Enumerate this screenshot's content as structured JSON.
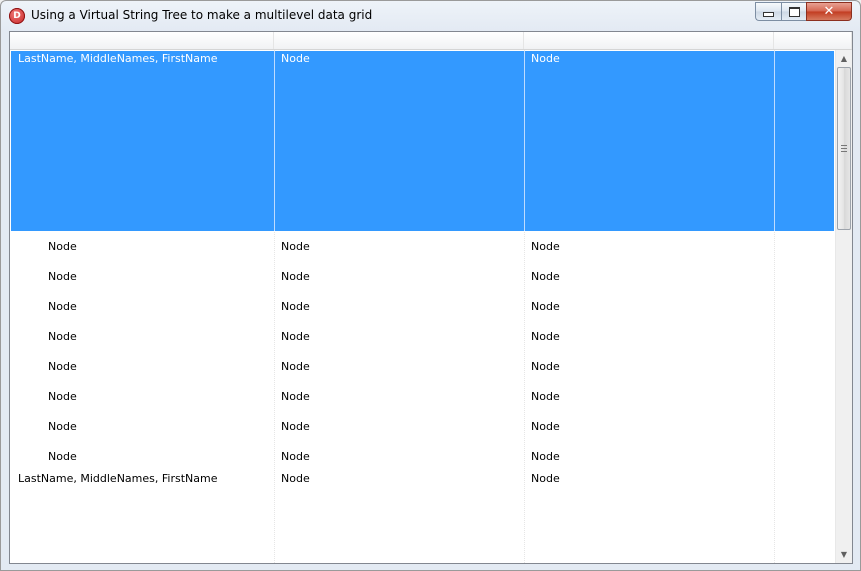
{
  "window": {
    "title": "Using a Virtual String Tree to make a multilevel data grid",
    "icon": "delphi-app-icon",
    "icon_letter": "D",
    "close_glyph": "✕"
  },
  "colors": {
    "selection": "#3399ff",
    "selection_text": "#ffffff",
    "grid_line": "#e6e6e6"
  },
  "grid": {
    "columns": [
      "",
      "",
      "",
      ""
    ],
    "rows": [
      {
        "level": 0,
        "selected": true,
        "cells": [
          "LastName, MiddleNames, FirstName",
          "Node",
          "Node"
        ]
      },
      {
        "level": 1,
        "selected": false,
        "cells": [
          "Node",
          "Node",
          "Node"
        ]
      },
      {
        "level": 1,
        "selected": false,
        "cells": [
          "Node",
          "Node",
          "Node"
        ]
      },
      {
        "level": 1,
        "selected": false,
        "cells": [
          "Node",
          "Node",
          "Node"
        ]
      },
      {
        "level": 1,
        "selected": false,
        "cells": [
          "Node",
          "Node",
          "Node"
        ]
      },
      {
        "level": 1,
        "selected": false,
        "cells": [
          "Node",
          "Node",
          "Node"
        ]
      },
      {
        "level": 1,
        "selected": false,
        "cells": [
          "Node",
          "Node",
          "Node"
        ]
      },
      {
        "level": 1,
        "selected": false,
        "cells": [
          "Node",
          "Node",
          "Node"
        ]
      },
      {
        "level": 1,
        "selected": false,
        "cells": [
          "Node",
          "Node",
          "Node"
        ]
      },
      {
        "level": 0,
        "selected": false,
        "cells": [
          "LastName, MiddleNames, FirstName",
          "Node",
          "Node"
        ]
      }
    ]
  },
  "scrollbar": {
    "up_arrow": "▲",
    "down_arrow": "▼",
    "position": 0.0
  }
}
